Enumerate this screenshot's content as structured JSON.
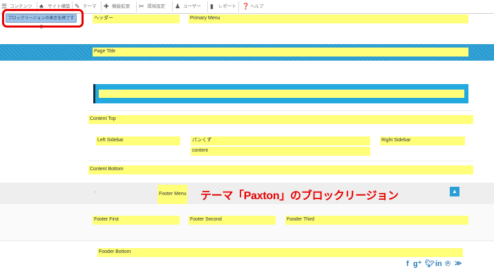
{
  "toolbar": {
    "items": [
      {
        "label": "コンテンツ",
        "icon": "content-icon"
      },
      {
        "label": "サイト構築",
        "icon": "sitemap-icon"
      },
      {
        "label": "テーマ",
        "icon": "brush-icon"
      },
      {
        "label": "機能拡張",
        "icon": "puzzle-icon"
      },
      {
        "label": "環境設定",
        "icon": "wrench-icon"
      },
      {
        "label": "ユーザー",
        "icon": "users-icon"
      },
      {
        "label": "レポート",
        "icon": "bar-chart-icon"
      },
      {
        "label": "ヘルプ",
        "icon": "help-icon"
      }
    ]
  },
  "demo_button": {
    "label": "ブロックリージョンの表示を終了する"
  },
  "regions": {
    "header": "ヘッダー",
    "primary_menu": "Primary Menu",
    "page_title": "Page Title",
    "breadcrumb_overlay": "パンくず",
    "content_top": "Content Top",
    "left_sidebar": "Left Sidebar",
    "breadcrumb": "パンくず",
    "content": "content",
    "right_sidebar": "Right Sidebar",
    "content_bottom": "Content Bottom",
    "footer_menu": "Footer Menu",
    "footer_first": "Footer First",
    "footer_second": "Footer Second",
    "footer_third": "Fooder Third",
    "footer_bottom": "Fooder Bottom"
  },
  "footer_dot": "·",
  "caption": "テーマ「Paxton」のブロックリージョン",
  "scroll_top_icon": "chevron-up-icon",
  "social_icons": [
    "facebook-icon",
    "google-plus-icon",
    "twitter-icon",
    "linkedin-icon",
    "pinterest-icon",
    "rss-icon"
  ],
  "colors": {
    "region_yellow": "#ffff7a",
    "accent_blue": "#2a9fd6",
    "highlight_red": "#e60000"
  }
}
